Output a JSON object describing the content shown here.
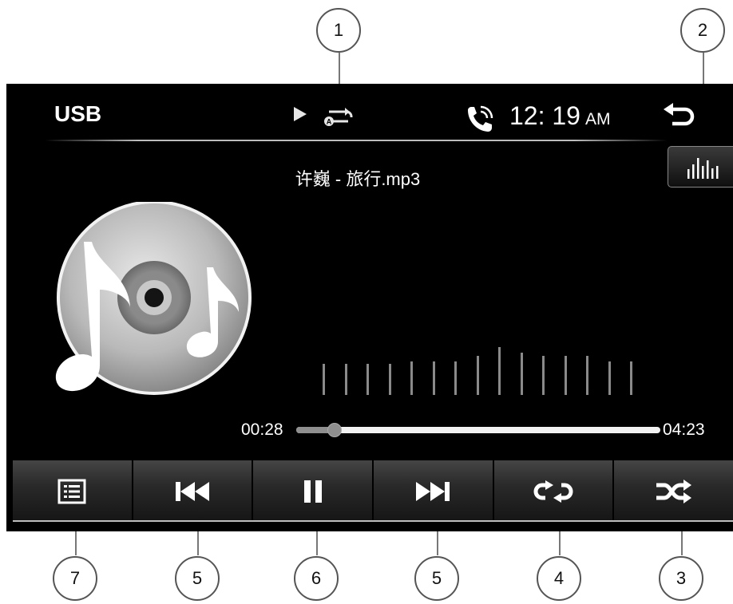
{
  "callouts": {
    "c1": "1",
    "c2": "2",
    "c3": "3",
    "c4": "4",
    "c5_prev": "5",
    "c5_next": "5",
    "c6": "6",
    "c7": "7"
  },
  "header": {
    "source": "USB",
    "time": "12: 19",
    "ampm": "AM",
    "play_state_icon": "play-icon",
    "repeat_mode_icon": "repeat-all-icon",
    "phone_icon": "bluetooth-phone-icon",
    "back_icon": "back-icon"
  },
  "eq_button_icon": "equalizer-icon",
  "track": {
    "title": "许巍 - 旅行.mp3"
  },
  "progress": {
    "elapsed": "00:28",
    "total": "04:23",
    "fraction": 0.106
  },
  "spectrum_levels": [
    0.55,
    0.55,
    0.55,
    0.55,
    0.6,
    0.6,
    0.6,
    0.7,
    0.85,
    0.75,
    0.7,
    0.7,
    0.7,
    0.6,
    0.6
  ],
  "controls": [
    {
      "id": "playlist",
      "icon": "playlist-icon"
    },
    {
      "id": "previous",
      "icon": "previous-track-icon"
    },
    {
      "id": "pause",
      "icon": "pause-icon"
    },
    {
      "id": "next",
      "icon": "next-track-icon"
    },
    {
      "id": "repeat",
      "icon": "repeat-icon"
    },
    {
      "id": "shuffle",
      "icon": "shuffle-icon"
    }
  ],
  "colors": {
    "screen_bg": "#000000",
    "text": "#ffffff",
    "progress_played": "#8f8f8f",
    "progress_remaining": "#f2f2f2"
  }
}
